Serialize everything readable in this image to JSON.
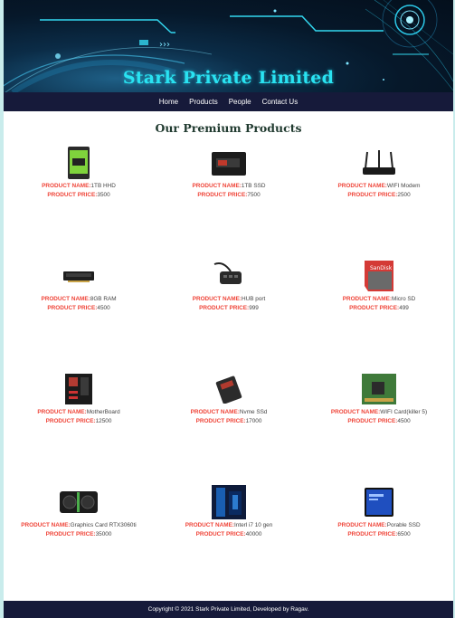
{
  "site_title": "Stark Private Limited",
  "nav": [
    "Home",
    "Products",
    "People",
    "Contact Us"
  ],
  "section_title": "Our Premium Products",
  "labels": {
    "name": "PRODUCT NAME:",
    "price": "PRODUCT PRICE:"
  },
  "products": [
    {
      "name": "1TB HHD",
      "price": "3500",
      "icon": "hard-drive-icon"
    },
    {
      "name": "1TB SSD",
      "price": "7500",
      "icon": "ssd-icon"
    },
    {
      "name": "WIFI Modem",
      "price": "2500",
      "icon": "wifi-router-icon"
    },
    {
      "name": "8GB RAM",
      "price": "4500",
      "icon": "ram-stick-icon"
    },
    {
      "name": "HUB port",
      "price": "999",
      "icon": "usb-hub-icon"
    },
    {
      "name": "Micro SD",
      "price": "499",
      "icon": "micro-sd-card-icon"
    },
    {
      "name": "MotherBoard",
      "price": "12500",
      "icon": "motherboard-icon"
    },
    {
      "name": "Nvme SSd",
      "price": "17000",
      "icon": "nvme-ssd-icon"
    },
    {
      "name": "WIFI Card(killer 5)",
      "price": "4500",
      "icon": "wifi-card-icon"
    },
    {
      "name": "Graphics Card RTX3060ti",
      "price": "35000",
      "icon": "graphics-card-icon"
    },
    {
      "name": "Interl i7 10 gen",
      "price": "40000",
      "icon": "processor-icon"
    },
    {
      "name": "Porable SSD",
      "price": "6500",
      "icon": "portable-ssd-icon"
    }
  ],
  "footer": "Copyright © 2021 Stark Private Limited, Developed by Ragav."
}
